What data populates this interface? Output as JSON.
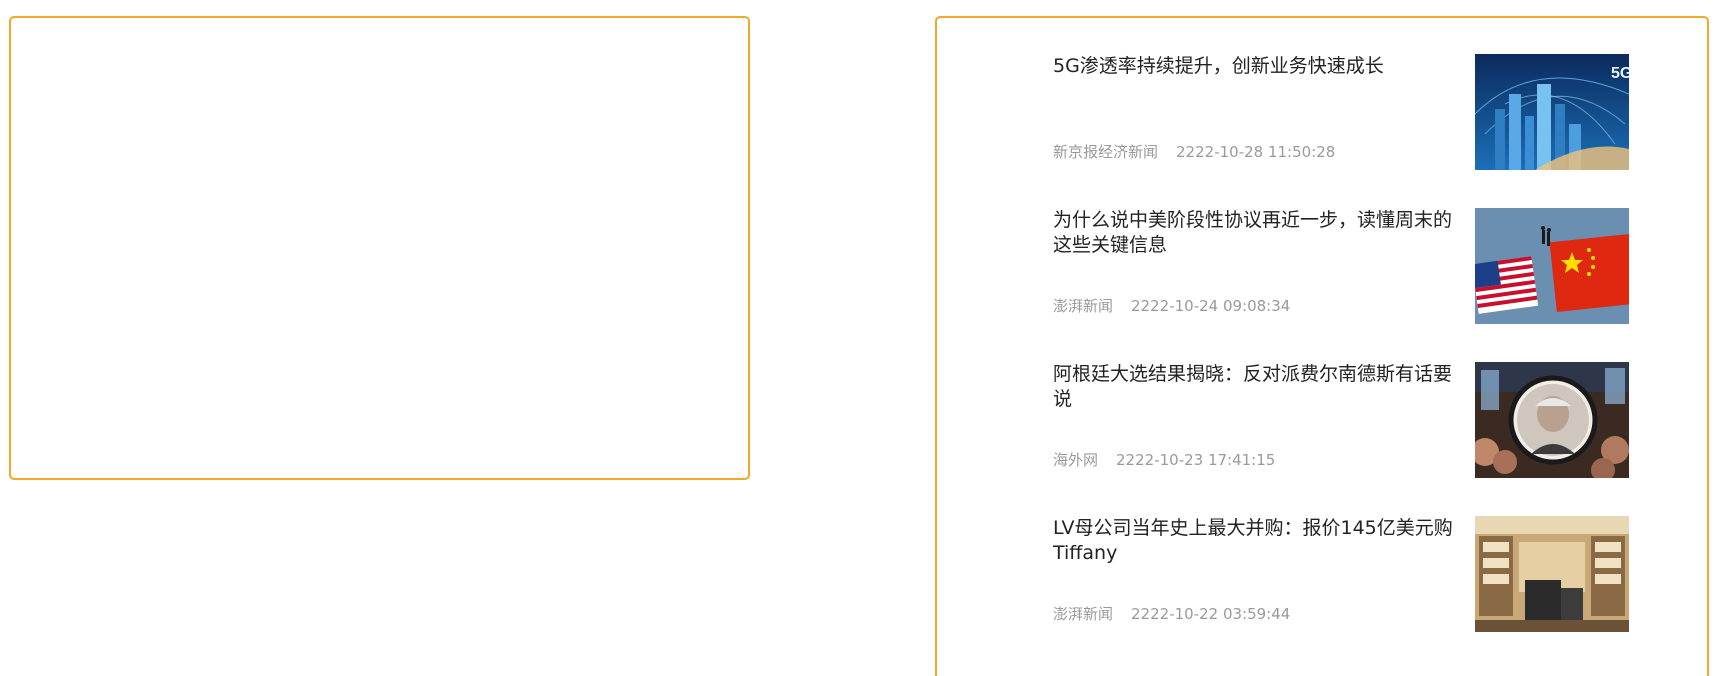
{
  "news": [
    {
      "title": "5G渗透率持续提升，创新业务快速成长",
      "source": "新京报经济新闻",
      "time": "2222-10-28 11:50:28"
    },
    {
      "title": "为什么说中美阶段性协议再近一步，读懂周末的这些关键信息",
      "source": "澎湃新闻",
      "time": "2222-10-24 09:08:34"
    },
    {
      "title": "阿根廷大选结果揭晓：反对派费尔南德斯有话要说",
      "source": "海外网",
      "time": "2222-10-23 17:41:15"
    },
    {
      "title": "LV母公司当年史上最大并购：报价145亿美元购Tiffany",
      "source": "澎湃新闻",
      "time": "2222-10-22 03:59:44"
    }
  ],
  "colors": {
    "panel_border": "#f2a72d",
    "title_text": "#222222",
    "meta_text": "#9a9a9a"
  }
}
